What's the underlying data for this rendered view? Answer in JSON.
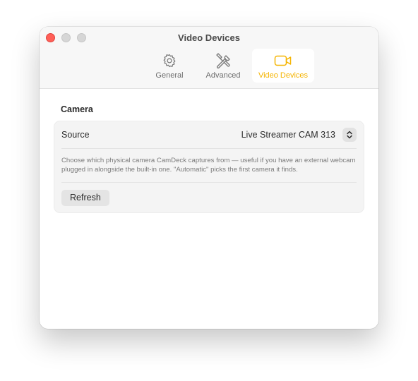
{
  "window": {
    "title": "Video Devices"
  },
  "toolbar": {
    "tabs": [
      {
        "label": "General",
        "icon": "gear-icon",
        "active": false
      },
      {
        "label": "Advanced",
        "icon": "tools-icon",
        "active": false
      },
      {
        "label": "Video Devices",
        "icon": "video-camera-icon",
        "active": true
      }
    ]
  },
  "camera_section": {
    "title": "Camera",
    "source_label": "Source",
    "source_value": "Live Streamer CAM 313",
    "description": "Choose which physical camera CamDeck captures from — useful if you have an external webcam plugged in alongside the built-in one. \"Automatic\" picks the first camera it finds.",
    "refresh_label": "Refresh"
  },
  "colors": {
    "accent": "#f5b400",
    "close": "#ff5f57"
  }
}
